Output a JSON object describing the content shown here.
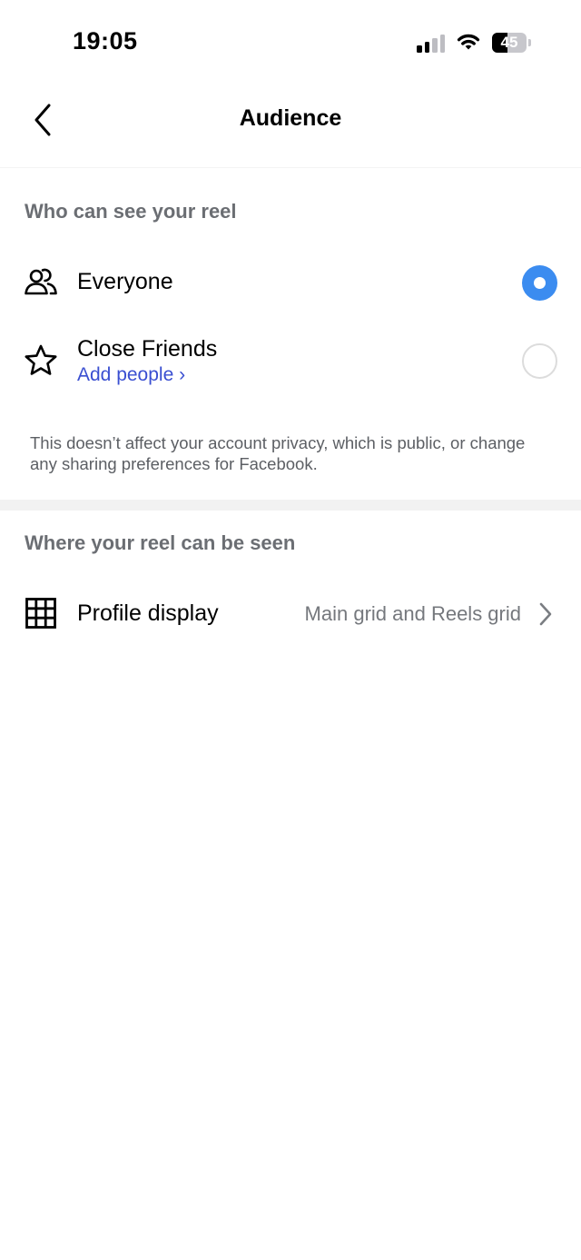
{
  "status_bar": {
    "time": "19:05",
    "battery_level": "45",
    "battery_percent": 45,
    "signal_bars_active": 2,
    "signal_bars_total": 4,
    "icons": [
      "signal-icon",
      "wifi-icon",
      "battery-icon"
    ]
  },
  "header": {
    "title": "Audience",
    "back_icon": "chevron-left-icon"
  },
  "audience_section": {
    "heading": "Who can see your reel",
    "options": [
      {
        "label": "Everyone",
        "icon": "people-icon",
        "selected": true
      },
      {
        "label": "Close Friends",
        "sublabel": "Add people ›",
        "icon": "star-icon",
        "selected": false
      }
    ],
    "note": "This doesn’t affect your account privacy, which is public, or change any sharing preferences for Facebook."
  },
  "visibility_section": {
    "heading": "Where your reel can be seen",
    "profile_display": {
      "label": "Profile display",
      "value": "Main grid and Reels grid",
      "icon": "grid-icon",
      "trailing_icon": "chevron-right-icon"
    }
  },
  "colors": {
    "accent": "#3b8cf0",
    "link": "#3a4fd1",
    "secondary_text": "#6b6e73",
    "divider": "#f2f2f2"
  }
}
